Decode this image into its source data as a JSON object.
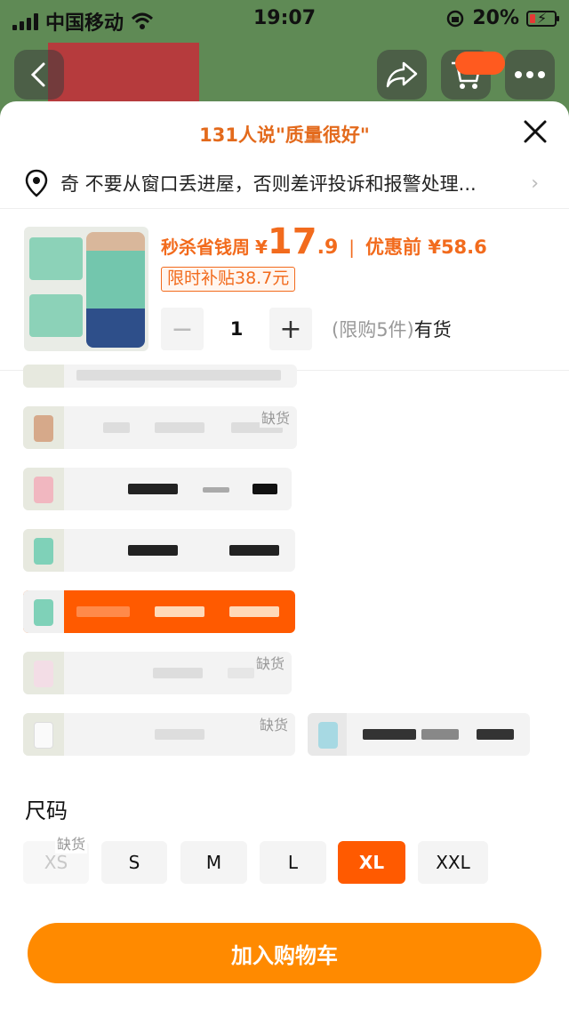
{
  "status_bar": {
    "carrier": "中国移动",
    "time": "19:07",
    "battery": "20%"
  },
  "sheet": {
    "quality_note": "131人说\"质量很好\"",
    "address": "奇 不要从窗口丢进屋，否则差评投诉和报警处理...",
    "product": {
      "price_label": "秒杀省钱周",
      "currency": "¥",
      "price_int": "17",
      "price_dec": ".9",
      "price_before": "优惠前 ¥58.6",
      "subsidy": "限时补贴38.7元",
      "quantity": "1",
      "limit": "(限购5件)",
      "stock": "有货"
    },
    "variants": {
      "out_of_stock_label": "缺货"
    },
    "size": {
      "title": "尺码",
      "options": [
        "XS",
        "S",
        "M",
        "L",
        "XL",
        "XXL"
      ],
      "out_of_stock_label": "缺货"
    },
    "add_to_cart": "加入购物车"
  },
  "colors": {
    "accent": "#ff5a00",
    "price": "#f26b1d",
    "cta": "#ff8a00"
  }
}
